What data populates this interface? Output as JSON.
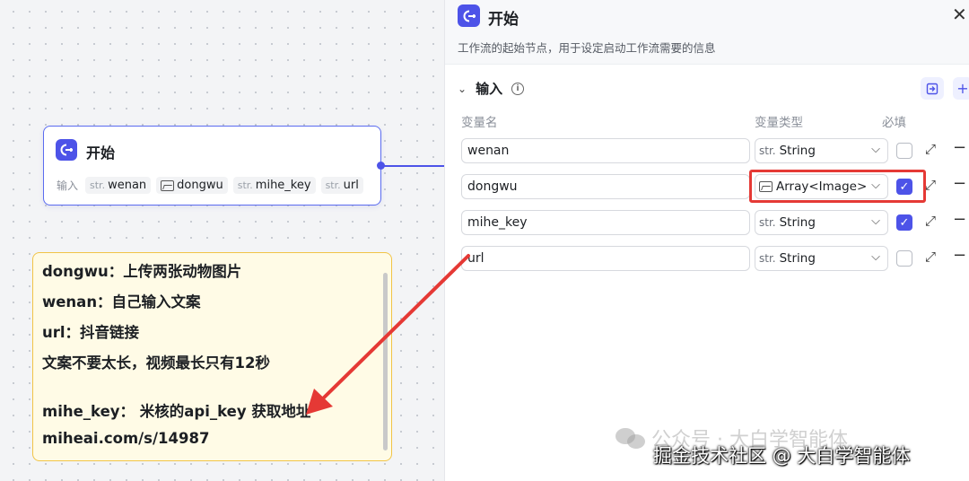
{
  "canvas": {
    "start_node": {
      "title": "开始",
      "inputs_label": "输入",
      "chips": [
        {
          "prefix": "str.",
          "name": "wenan"
        },
        {
          "prefix": "img",
          "name": "dongwu"
        },
        {
          "prefix": "str.",
          "name": "mihe_key"
        },
        {
          "prefix": "str.",
          "name": "url"
        }
      ]
    },
    "note": {
      "lines": [
        "dongwu：上传两张动物图片",
        "wenan：自己输入文案",
        "url：抖音链接",
        "文案不要太长，视频最长只有12秒",
        "",
        "mihe_key： 米核的api_key 获取地址",
        "miheai.com/s/14987"
      ]
    }
  },
  "panel": {
    "title": "开始",
    "description": "工作流的起始节点，用于设定启动工作流需要的信息",
    "section_title": "输入",
    "columns": {
      "name": "变量名",
      "type": "变量类型",
      "required": "必填"
    },
    "rows": [
      {
        "name": "wenan",
        "type_prefix": "str.",
        "type": "String",
        "required": false
      },
      {
        "name": "dongwu",
        "type_prefix": "img",
        "type": "Array<Image>",
        "required": true
      },
      {
        "name": "mihe_key",
        "type_prefix": "str.",
        "type": "String",
        "required": true
      },
      {
        "name": "url",
        "type_prefix": "str.",
        "type": "String",
        "required": false
      }
    ]
  },
  "watermarks": {
    "line1": "公众号 · 大白学智能体",
    "line2": "掘金技术社区 @ 大白学智能体"
  },
  "colors": {
    "accent": "#4d53e8",
    "highlight": "#e53935",
    "note_bg": "#fffbe6",
    "note_border": "#f1c447"
  }
}
